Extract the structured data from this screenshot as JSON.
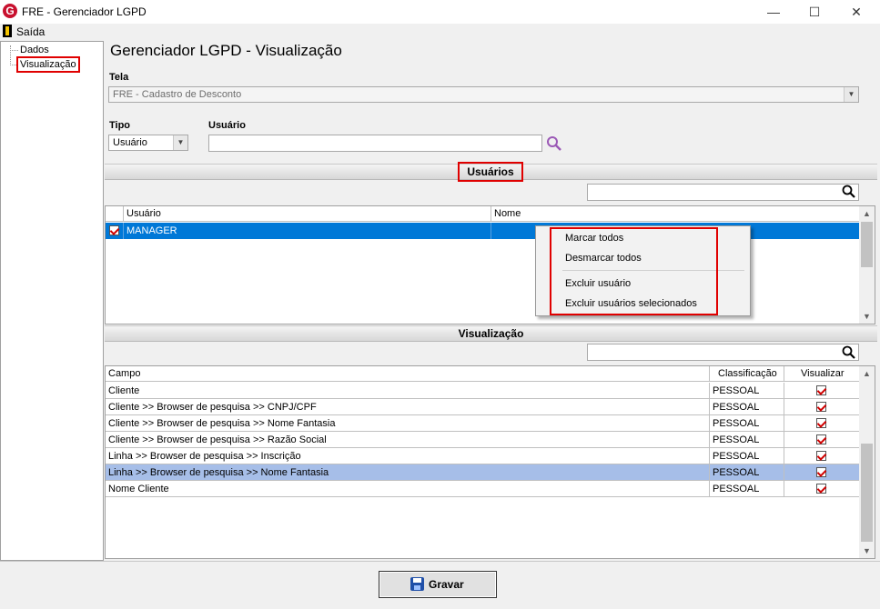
{
  "window": {
    "title": "FRE - Gerenciador LGPD",
    "logo_letter": "G",
    "minimize_glyph": "—",
    "maximize_glyph": "☐",
    "close_glyph": "✕"
  },
  "menu": {
    "exit_label": "Saída"
  },
  "tree": {
    "items": [
      {
        "label": "Dados"
      },
      {
        "label": "Visualização"
      }
    ]
  },
  "page_title": "Gerenciador LGPD - Visualização",
  "filters": {
    "tela_label": "Tela",
    "tela_value": "FRE - Cadastro de Desconto",
    "tipo_label": "Tipo",
    "tipo_value": "Usuário",
    "usuario_label": "Usuário",
    "usuario_value": ""
  },
  "users_section": {
    "title": "Usuários",
    "search_value": "",
    "columns": [
      "Usuário",
      "Nome"
    ],
    "rows": [
      {
        "checked": true,
        "usuario": "MANAGER",
        "nome": ""
      }
    ]
  },
  "context_menu": {
    "items": [
      "Marcar todos",
      "Desmarcar todos",
      "Excluir usuário",
      "Excluir usuários selecionados"
    ]
  },
  "view_section": {
    "title": "Visualização",
    "search_value": "",
    "columns": [
      "Campo",
      "Classificação",
      "Visualizar"
    ],
    "rows": [
      {
        "campo": "Cliente",
        "classificacao": "PESSOAL",
        "visualizar": true
      },
      {
        "campo": "Cliente >> Browser de pesquisa >> CNPJ/CPF",
        "classificacao": "PESSOAL",
        "visualizar": true
      },
      {
        "campo": "Cliente >> Browser de pesquisa >> Nome Fantasia",
        "classificacao": "PESSOAL",
        "visualizar": true
      },
      {
        "campo": "Cliente >> Browser de pesquisa >> Razão Social",
        "classificacao": "PESSOAL",
        "visualizar": true
      },
      {
        "campo": "Linha >> Browser de pesquisa >> Inscrição",
        "classificacao": "PESSOAL",
        "visualizar": true
      },
      {
        "campo": "Linha >> Browser de pesquisa >> Nome Fantasia",
        "classificacao": "PESSOAL",
        "visualizar": true,
        "selected": true
      },
      {
        "campo": "Nome Cliente",
        "classificacao": "PESSOAL",
        "visualizar": true
      }
    ]
  },
  "footer": {
    "save_label": "Gravar"
  },
  "icons": {
    "search": "search-icon",
    "user_search": "user-search-icon",
    "dropdown": "chevron-down-icon",
    "scroll_up": "scroll-up-arrow-icon",
    "scroll_down": "scroll-down-arrow-icon",
    "save": "floppy-disk-icon",
    "exit": "door-exit-icon"
  },
  "colors": {
    "selection_blue": "#0078d7",
    "selection_soft": "#a6bee8",
    "highlight_red": "#e00000",
    "check_red": "#d00000",
    "logo_red": "#c8102e",
    "search_purple": "#9b59b6"
  }
}
